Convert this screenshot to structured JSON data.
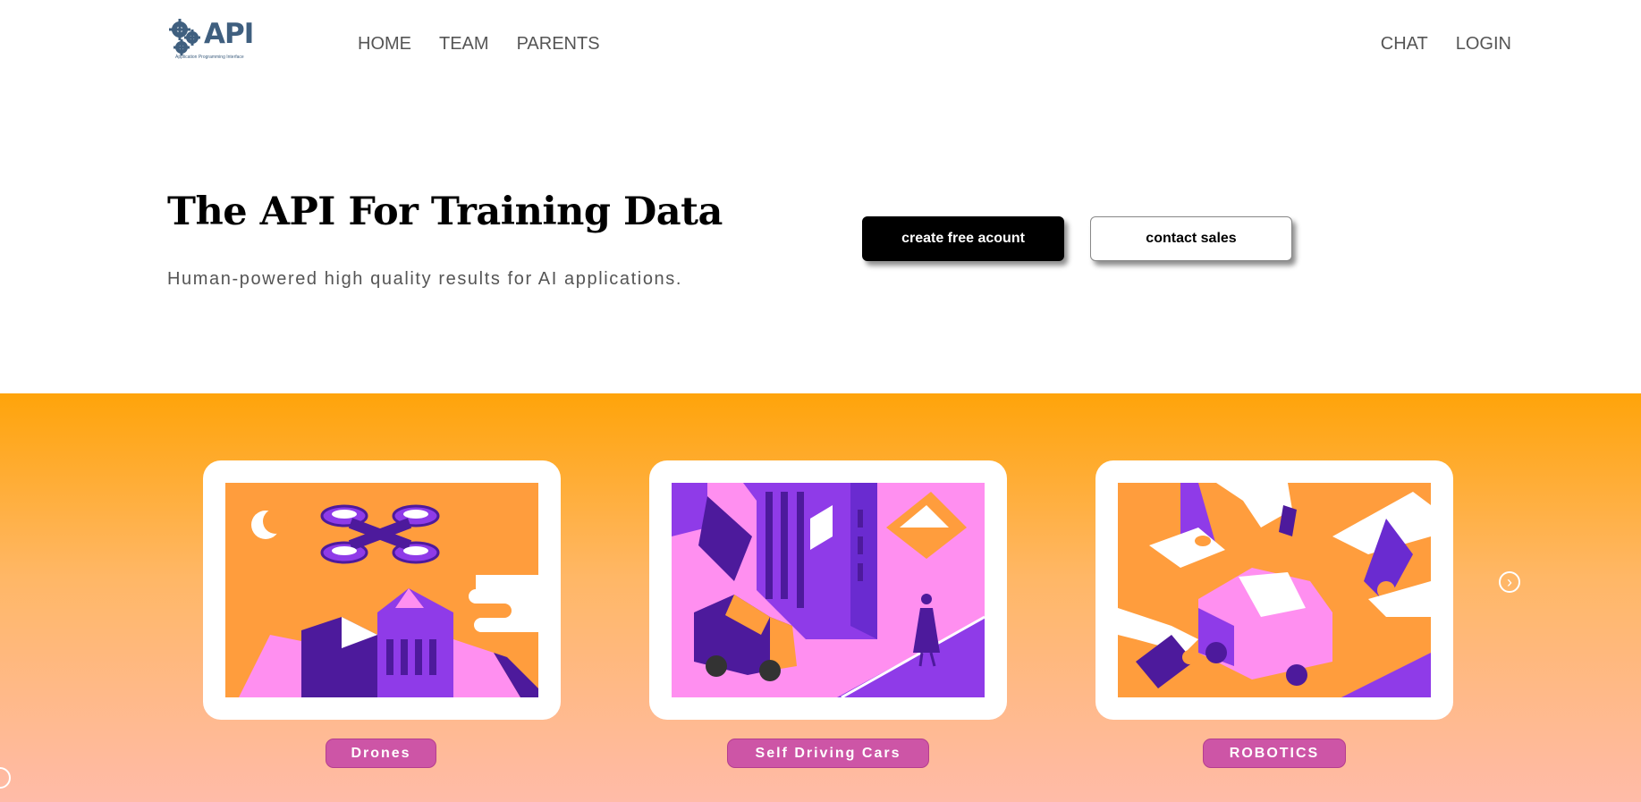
{
  "header": {
    "logo_text": "API",
    "logo_tagline": "Application Programming Interface",
    "nav_left": [
      "HOME",
      "TEAM",
      "PARENTS"
    ],
    "nav_right": [
      "CHAT",
      "LOGIN"
    ]
  },
  "hero": {
    "title": "The API For Training Data",
    "subtitle": "Human-powered high quality results for AI applications.",
    "primary_button": "create free acount",
    "secondary_button": "contact sales"
  },
  "categories": [
    {
      "label": "Drones",
      "icon": "drone-illustration"
    },
    {
      "label": "Self Driving Cars",
      "icon": "city-car-illustration"
    },
    {
      "label": "ROBOTICS",
      "icon": "robot-arm-illustration"
    }
  ],
  "colors": {
    "orange": "#ffa40a",
    "peach": "#ffbba8",
    "pill": "#cd55a6",
    "purple": "#6a2bd0",
    "pink": "#ff8ff0",
    "logo": "#3f5f7f"
  }
}
